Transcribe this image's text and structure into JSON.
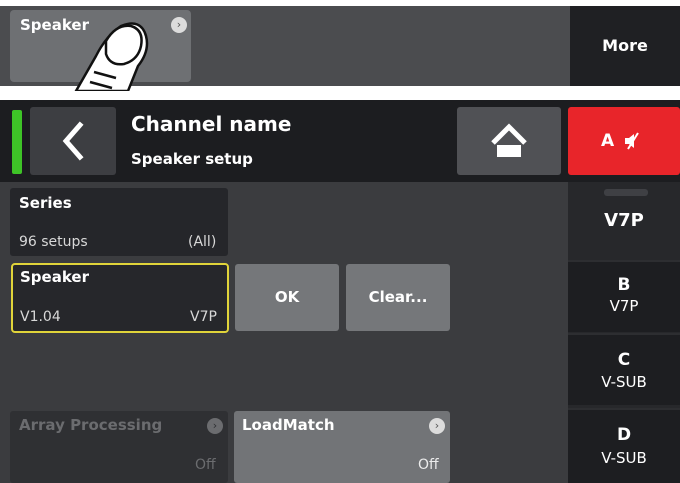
{
  "top_strip": {
    "speaker_label": "Speaker",
    "more_label": "More"
  },
  "header": {
    "channel_title": "Channel name",
    "subtitle": "Speaker setup",
    "mute_label": "A",
    "channel_indicator_color": "#3ec427",
    "mute_color": "#e8252a"
  },
  "series": {
    "title": "Series",
    "count": "96 setups",
    "filter": "(All)"
  },
  "speaker": {
    "title": "Speaker",
    "version": "V1.04",
    "model": "V7P",
    "highlight_color": "#e0d43a"
  },
  "buttons": {
    "ok": "OK",
    "clear": "Clear..."
  },
  "array_processing": {
    "title": "Array Processing",
    "value": "Off"
  },
  "loadmatch": {
    "title": "LoadMatch",
    "value": "Off"
  },
  "channels": {
    "active": "V7P",
    "tabs": [
      {
        "letter": "B",
        "value": "V7P"
      },
      {
        "letter": "C",
        "value": "V-SUB"
      },
      {
        "letter": "D",
        "value": "V-SUB"
      }
    ]
  }
}
